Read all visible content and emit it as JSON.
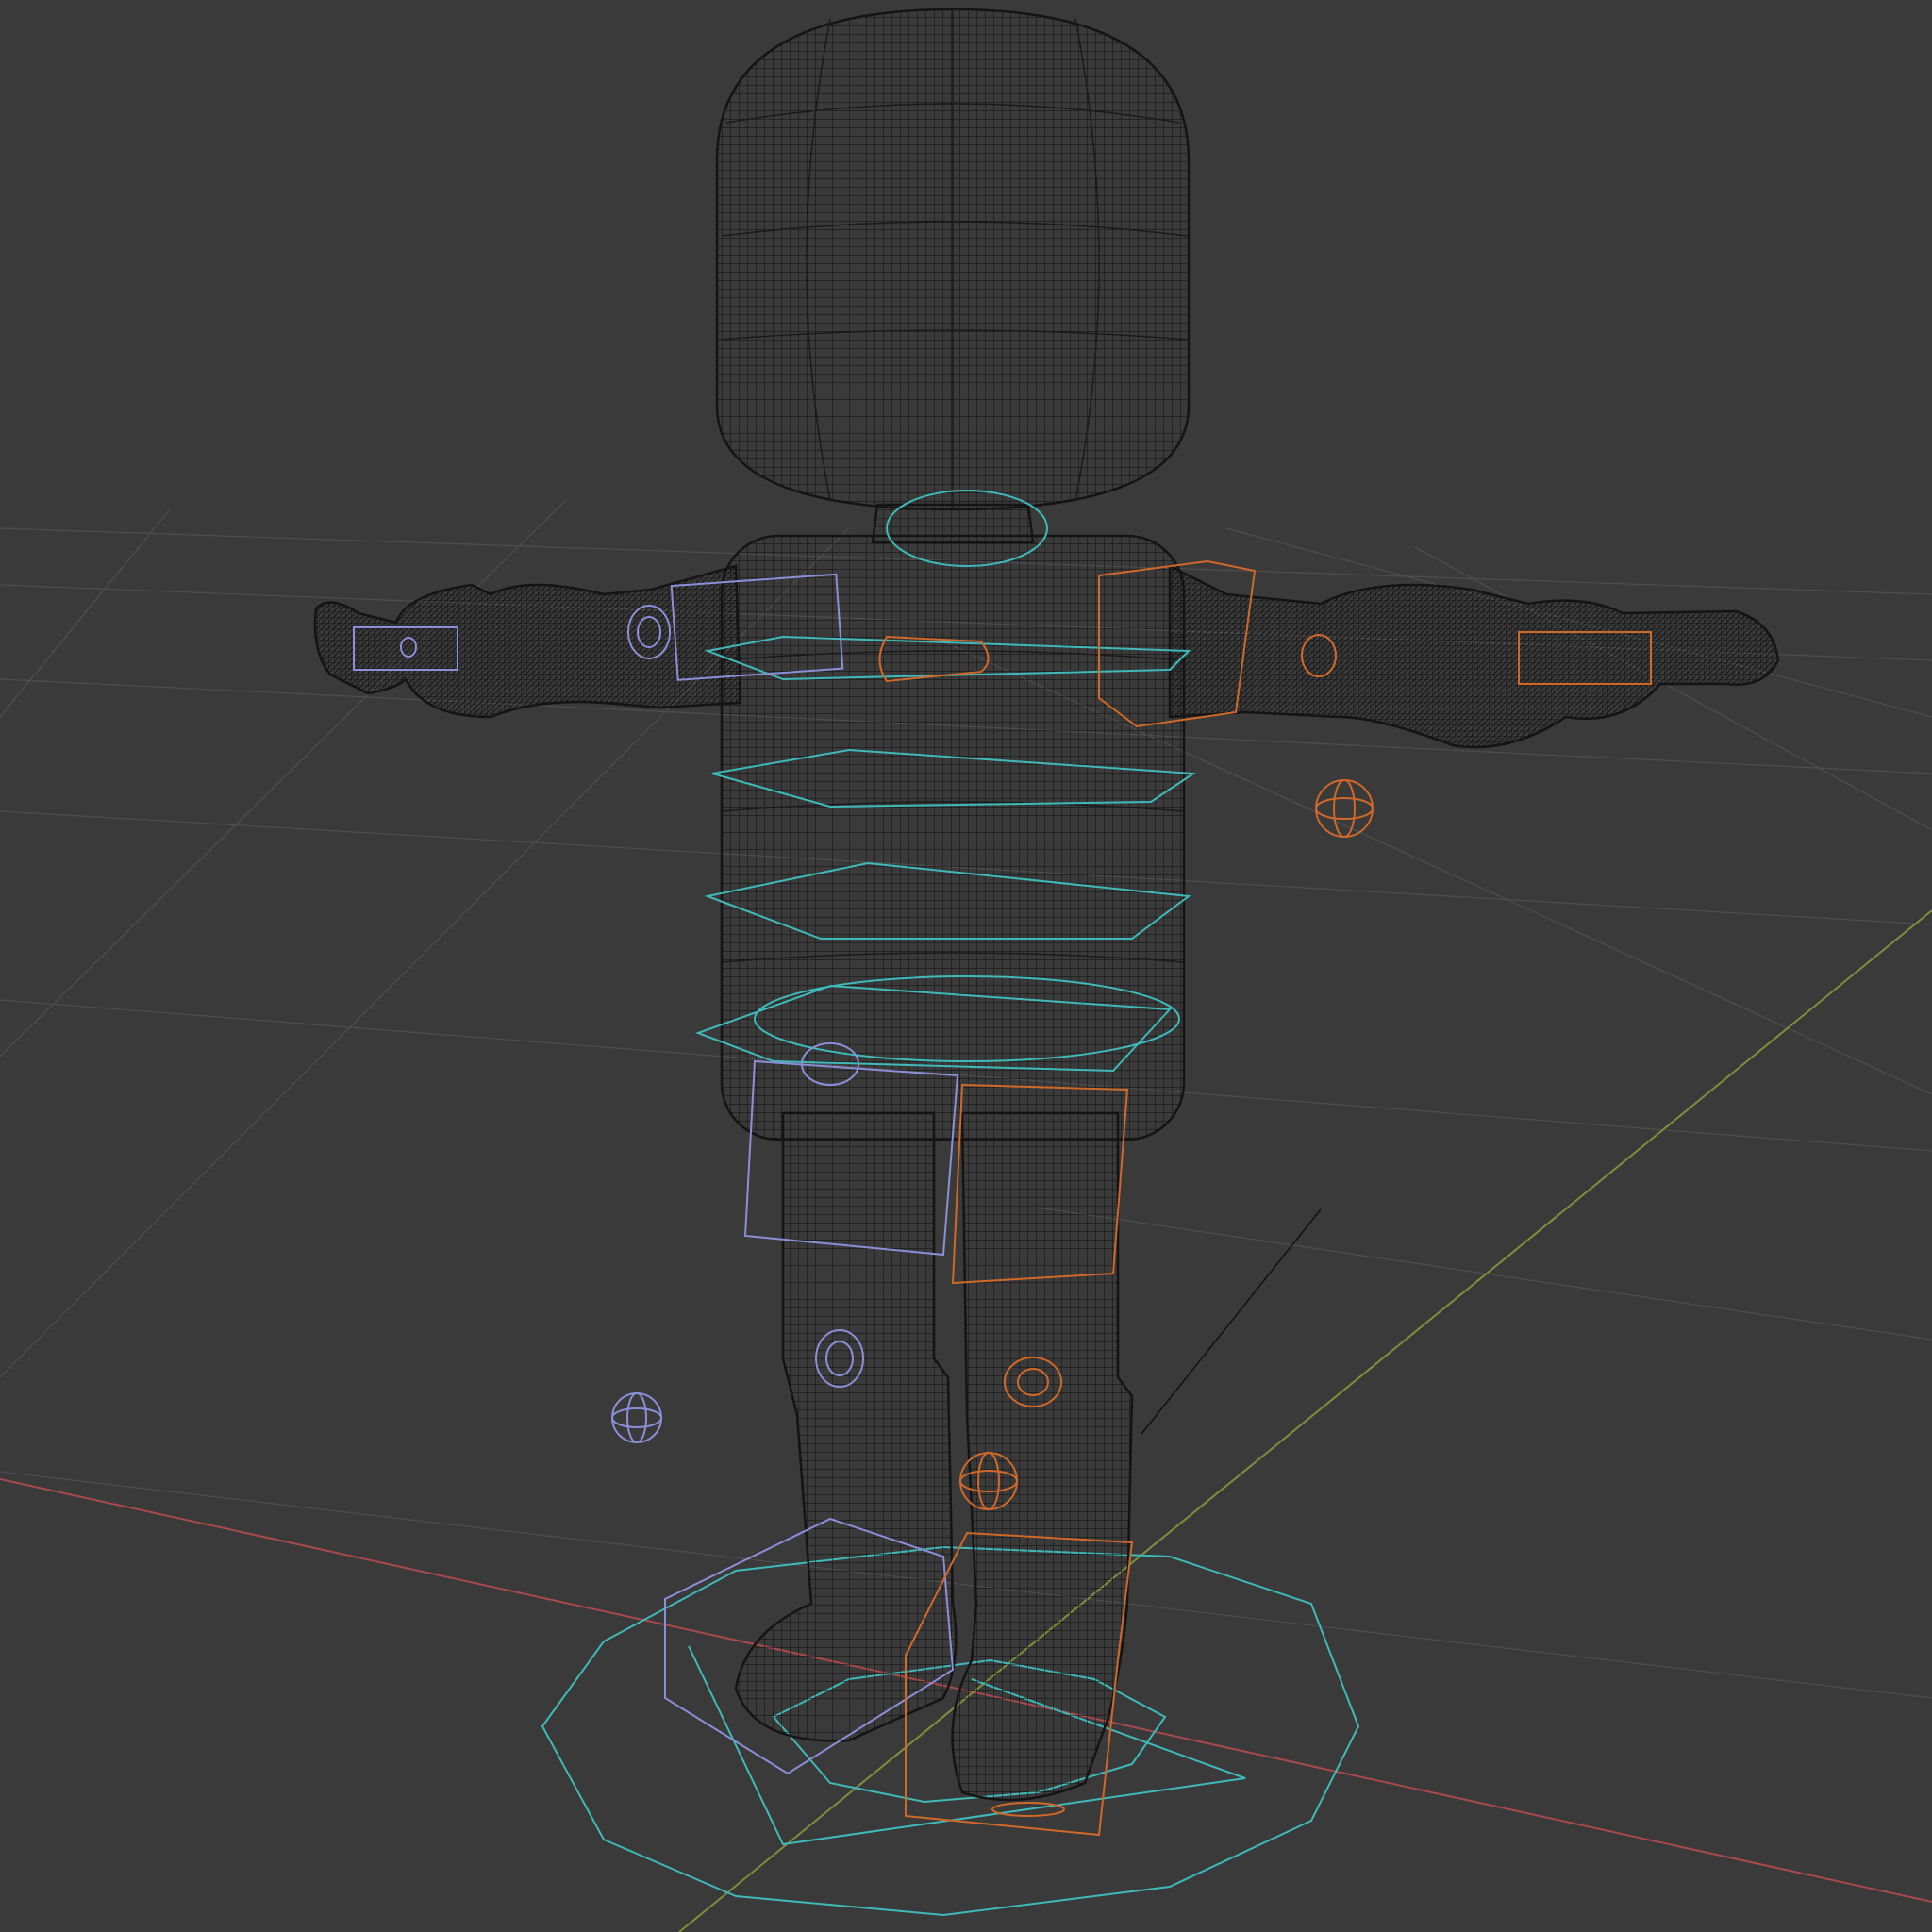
{
  "viewport": {
    "name": "3D Viewport",
    "shading": "wireframe",
    "background": "#3a3a3a"
  },
  "colors": {
    "grid": "#505050",
    "x_axis": "#a84a4a",
    "y_axis": "#7d8f3a",
    "mesh": "#141414",
    "ctrl_left": "#8b8fd8",
    "ctrl_right": "#d0682a",
    "ctrl_center": "#3fb9b9"
  },
  "scene": {
    "objects": [
      {
        "name": "character-mesh",
        "type": "mesh"
      },
      {
        "name": "root-control",
        "type": "circle"
      },
      {
        "name": "torso-controls",
        "type": "ring-stack",
        "count": 5
      },
      {
        "name": "arm-ik-left",
        "type": "bone-shape"
      },
      {
        "name": "arm-ik-right",
        "type": "bone-shape"
      },
      {
        "name": "leg-ik-left",
        "type": "bone-shape"
      },
      {
        "name": "leg-ik-right",
        "type": "bone-shape"
      },
      {
        "name": "pole-target-left",
        "type": "sphere-gizmo"
      },
      {
        "name": "pole-target-right",
        "type": "sphere-gizmo"
      }
    ]
  }
}
